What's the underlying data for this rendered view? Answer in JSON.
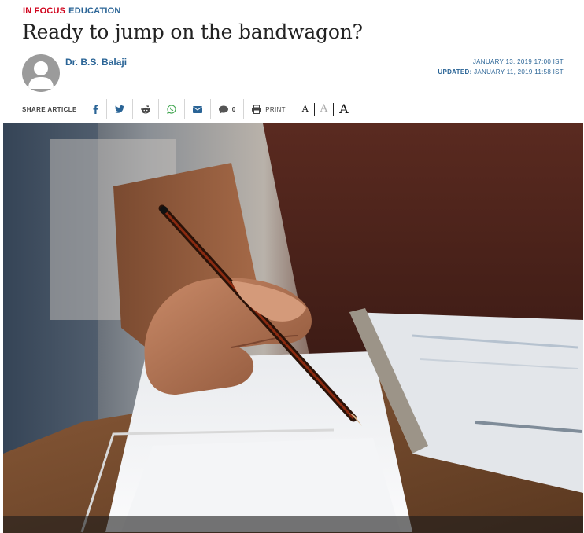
{
  "kicker": {
    "section": "IN FOCUS",
    "category": "EDUCATION"
  },
  "article": {
    "title": "Ready to jump on the bandwagon?",
    "author": "Dr. B.S. Balaji",
    "published": "JANUARY 13, 2019 17:00 IST",
    "updated_label": "UPDATED:",
    "updated": "JANUARY 11, 2019 11:58 IST"
  },
  "share": {
    "label": "SHARE ARTICLE",
    "comment_count": "0",
    "print_label": "PRINT",
    "icons": [
      "facebook-icon",
      "twitter-icon",
      "reddit-icon",
      "whatsapp-icon",
      "mail-icon",
      "comment-icon",
      "print-icon"
    ]
  },
  "font_size": {
    "small": "A",
    "medium": "A",
    "large": "A"
  },
  "colors": {
    "kicker_red": "#d0021b",
    "link_blue": "#2a6496"
  }
}
